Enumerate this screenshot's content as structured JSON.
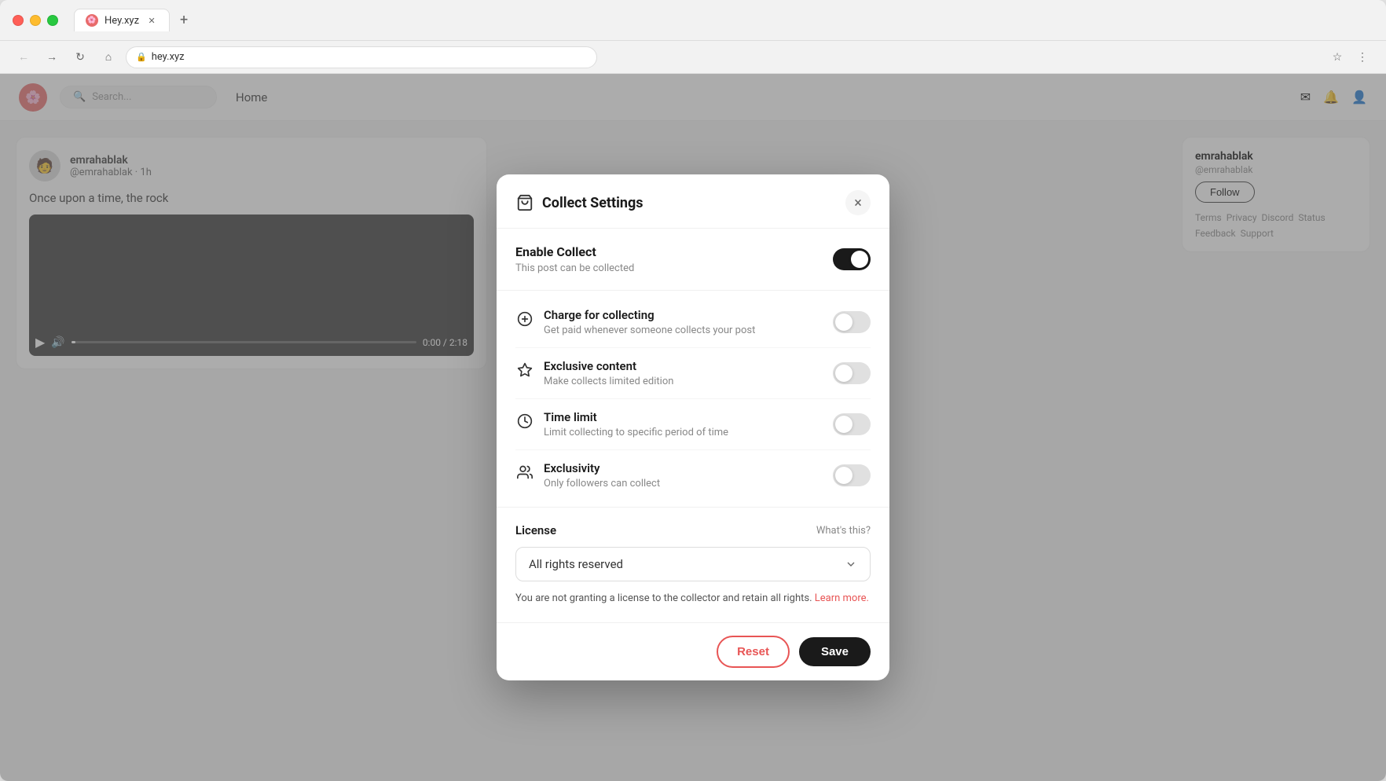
{
  "browser": {
    "traffic_lights": [
      "red",
      "yellow",
      "green"
    ],
    "tab_title": "Hey.xyz",
    "tab_favicon": "🌸",
    "new_tab_label": "+",
    "address": "hey.xyz",
    "lock_icon": "🔒"
  },
  "site": {
    "logo": "🌸",
    "search_placeholder": "Search...",
    "nav_items": [
      "Home"
    ],
    "post": {
      "author": "emrahablak",
      "handle": "@emrahablak · 1h",
      "text": "Once upon a time, the rock",
      "video_time": "0:00 / 2:18"
    },
    "sidebar": {
      "author": "emrahablak",
      "handle": "@emrahablak",
      "follow_label": "Follow",
      "links": [
        "Terms",
        "Privacy",
        "Discord",
        "Status",
        "Feedback",
        "Support"
      ]
    }
  },
  "modal": {
    "title": "Collect Settings",
    "close_label": "×",
    "enable_collect": {
      "title": "Enable Collect",
      "description": "This post can be collected",
      "enabled": true
    },
    "options": [
      {
        "id": "charge",
        "icon": "💲",
        "title": "Charge for collecting",
        "description": "Get paid whenever someone collects your post",
        "enabled": false
      },
      {
        "id": "exclusive",
        "icon": "⭐",
        "title": "Exclusive content",
        "description": "Make collects limited edition",
        "enabled": false
      },
      {
        "id": "timelimit",
        "icon": "🕐",
        "title": "Time limit",
        "description": "Limit collecting to specific period of time",
        "enabled": false
      },
      {
        "id": "exclusivity",
        "icon": "👥",
        "title": "Exclusivity",
        "description": "Only followers can collect",
        "enabled": false
      }
    ],
    "license": {
      "label": "License",
      "whats_this": "What's this?",
      "selected": "All rights reserved",
      "description": "You are not granting a license to the collector and retain all rights.",
      "learn_more": "Learn more."
    },
    "footer": {
      "reset_label": "Reset",
      "save_label": "Save"
    }
  }
}
